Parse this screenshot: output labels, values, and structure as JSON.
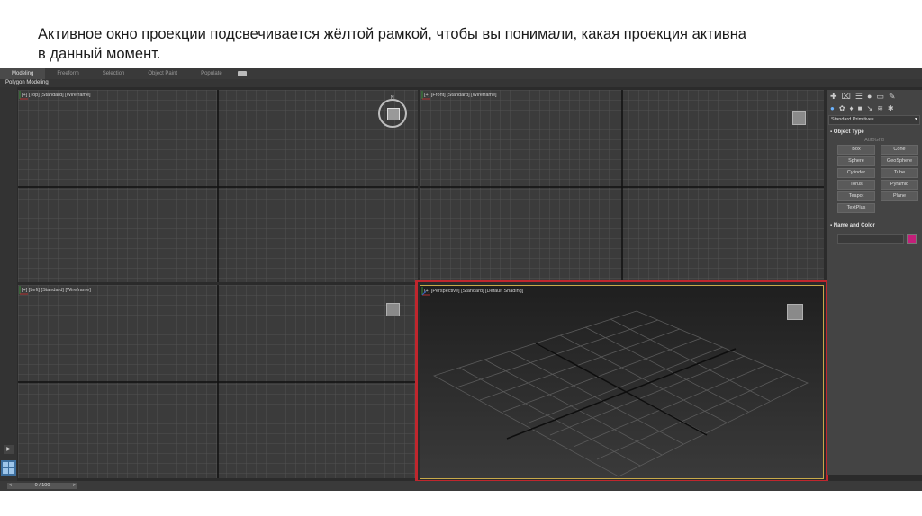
{
  "caption": {
    "line1": "Активное окно проекции подсвечивается жёлтой рамкой, чтобы вы понимали, какая проекция активна",
    "line2": "в данный момент."
  },
  "ribbon": {
    "tabs": [
      {
        "label": "Modeling",
        "active": true
      },
      {
        "label": "Freeform",
        "active": false
      },
      {
        "label": "Selection",
        "active": false
      },
      {
        "label": "Object Paint",
        "active": false
      },
      {
        "label": "Populate",
        "active": false
      }
    ],
    "sub_label": "Polygon Modeling"
  },
  "viewports": {
    "top": {
      "label": "[+] [Top] [Standard] [Wireframe]"
    },
    "front": {
      "label": "[+] [Front] [Standard] [Wireframe]"
    },
    "left": {
      "label": "[+] [Left] [Standard] [Wireframe]"
    },
    "perspective": {
      "label": "[+] [Perspective] [Standard] [Default Shading]",
      "active": true
    }
  },
  "command_panel": {
    "dropdown": "Standard Primitives",
    "object_type_title": "Object Type",
    "autogrid": "AutoGrid",
    "buttons": [
      "Box",
      "Cone",
      "Sphere",
      "GeoSphere",
      "Cylinder",
      "Tube",
      "Torus",
      "Pyramid",
      "Teapot",
      "Plane",
      "TextPlus"
    ],
    "name_color_title": "Name and Color",
    "color": "#c41f7a"
  },
  "timeline": {
    "frame": "0 / 100"
  },
  "colors": {
    "active_frame": "#c0262d",
    "active_inner": "#c8a94a",
    "accent": "#6bb3ff"
  }
}
